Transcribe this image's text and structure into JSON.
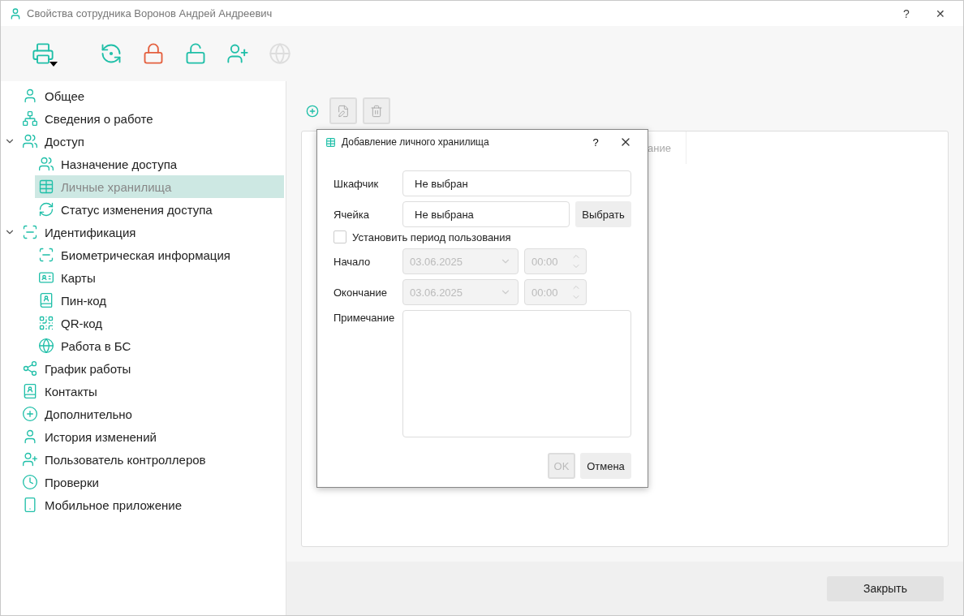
{
  "window": {
    "title": "Свойства сотрудника Воронов Андрей Андреевич",
    "help": "?",
    "close": "✕"
  },
  "toolbar": [
    {
      "kind": "print",
      "disabled": false
    },
    {
      "kind": "sync-lock",
      "disabled": false
    },
    {
      "kind": "lock",
      "disabled": false
    },
    {
      "kind": "unlock",
      "disabled": false
    },
    {
      "kind": "add-user",
      "disabled": false
    },
    {
      "kind": "globe",
      "disabled": true
    }
  ],
  "sidebar": {
    "items": [
      {
        "label": "Общее",
        "kind": "user",
        "selected": false
      },
      {
        "label": "Сведения о работе",
        "kind": "org",
        "selected": false
      },
      {
        "label": "Доступ",
        "kind": "users-plus",
        "selected": false,
        "expanded": true,
        "children": [
          {
            "label": "Назначение доступа",
            "kind": "users-plus",
            "selected": false
          },
          {
            "label": "Личные хранилища",
            "kind": "table",
            "selected": true
          },
          {
            "label": "Статус изменения доступа",
            "kind": "refresh",
            "selected": false
          }
        ]
      },
      {
        "label": "Идентификация",
        "kind": "scan",
        "selected": false,
        "expanded": true,
        "children": [
          {
            "label": "Биометрическая информация",
            "kind": "scan",
            "selected": false
          },
          {
            "label": "Карты",
            "kind": "card",
            "selected": false
          },
          {
            "label": "Пин-код",
            "kind": "book",
            "selected": false
          },
          {
            "label": "QR-код",
            "kind": "qr",
            "selected": false
          },
          {
            "label": "Работа в БС",
            "kind": "globe",
            "selected": false
          }
        ]
      },
      {
        "label": "График работы",
        "kind": "share",
        "selected": false
      },
      {
        "label": "Контакты",
        "kind": "book",
        "selected": false
      },
      {
        "label": "Дополнительно",
        "kind": "plus",
        "selected": false
      },
      {
        "label": "История изменений",
        "kind": "user",
        "selected": false
      },
      {
        "label": "Пользователь контроллеров",
        "kind": "user-plus",
        "selected": false
      },
      {
        "label": "Проверки",
        "kind": "clock",
        "selected": false
      },
      {
        "label": "Мобильное приложение",
        "kind": "phone",
        "selected": false
      }
    ]
  },
  "content_toolbar": [
    {
      "kind": "add",
      "disabled": false
    },
    {
      "kind": "edit",
      "disabled": true
    },
    {
      "kind": "delete",
      "disabled": true
    }
  ],
  "table": {
    "columns": [
      "ание"
    ]
  },
  "dialog": {
    "title": "Добавление личного хранилища",
    "help": "?",
    "cabinet": {
      "label": "Шкафчик",
      "value": "Не выбран"
    },
    "cell": {
      "label": "Ячейка",
      "value": "Не выбрана",
      "button": "Выбрать"
    },
    "period": {
      "label": "Установить период пользования",
      "checked": false
    },
    "start": {
      "label": "Начало",
      "date": "03.06.2025",
      "time": "00:00",
      "disabled": true
    },
    "end": {
      "label": "Окончание",
      "date": "03.06.2025",
      "time": "00:00",
      "disabled": true
    },
    "note": {
      "label": "Примечание"
    },
    "ok": {
      "label": "OK",
      "disabled": true
    },
    "cancel": {
      "label": "Отмена"
    }
  },
  "footer": {
    "close": "Закрыть"
  }
}
